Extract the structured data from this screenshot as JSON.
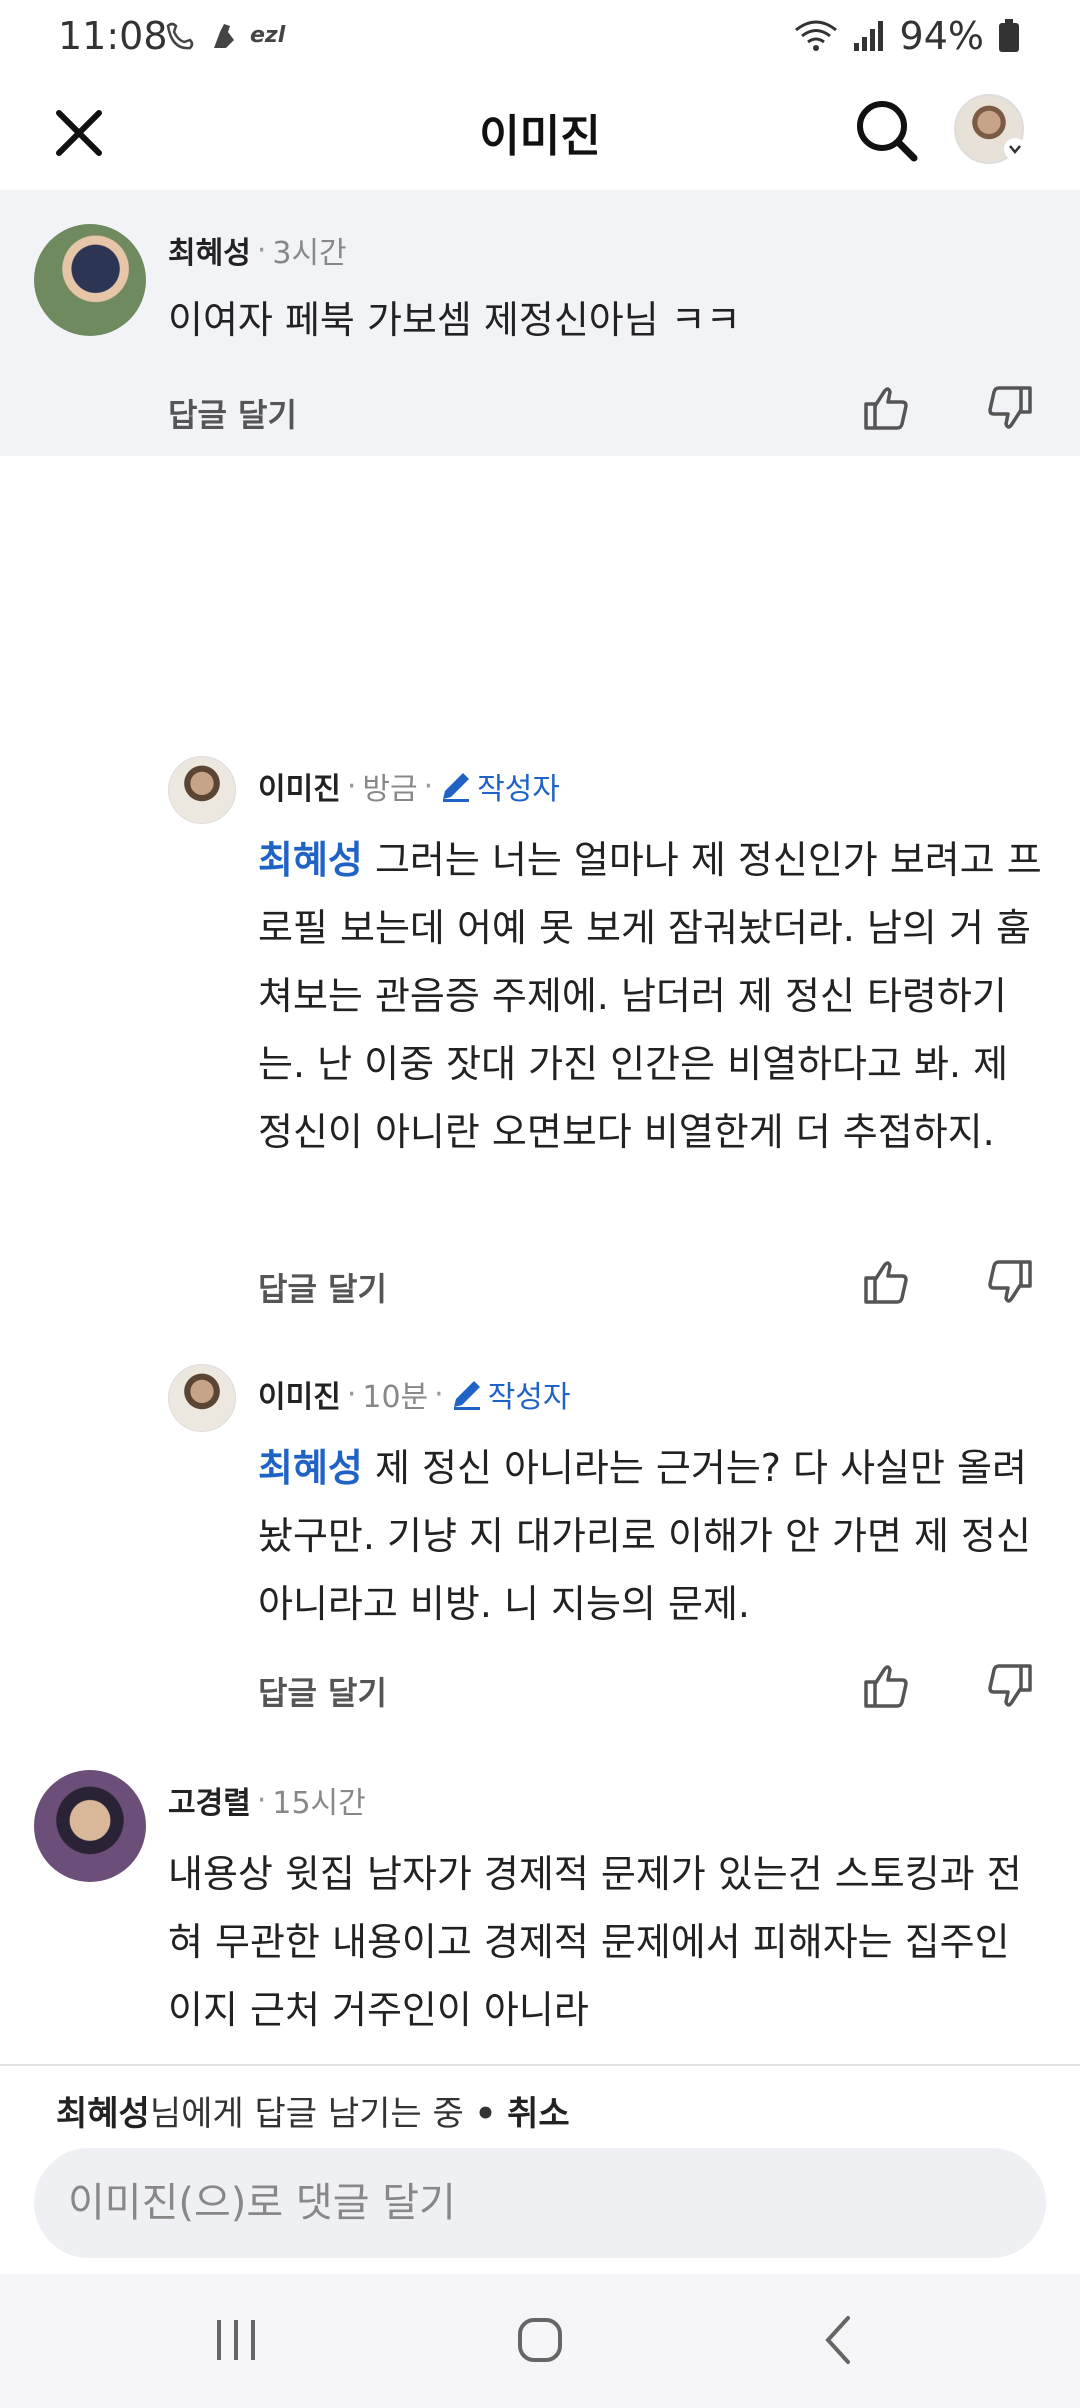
{
  "status_bar": {
    "time": "11:08",
    "app_icons": [
      "who-icon",
      "dog-icon",
      "ezl-icon"
    ],
    "ezl_label": "ezl",
    "battery": "94%"
  },
  "header": {
    "title": "이미진",
    "close_icon": "close-icon",
    "search_icon": "search-icon"
  },
  "comments": [
    {
      "author": "최혜성",
      "time": "3시간",
      "text": "이여자 페북 가보셈 제정신아님 ㅋㅋ",
      "reply_label": "답글 달기"
    },
    {
      "author": "이미진",
      "time": "방금",
      "author_tag": "작성자",
      "mention": "최혜성",
      "text": " 그러는 너는 얼마나 제 정신인가 보려고 프로필 보는데 어예 못 보게 잠궈놨더라. 남의 거 훔쳐보는 관음증 주제에. 남더러 제 정신 타령하기는. 난 이중 잣대 가진 인간은 비열하다고 봐. 제 정신이 아니란 오면보다 비열한게 더 추접하지.",
      "reply_label": "답글 달기"
    },
    {
      "author": "이미진",
      "time": "10분",
      "author_tag": "작성자",
      "mention": "최혜성",
      "text": " 제 정신 아니라는 근거는? 다 사실만 올려놨구만. 기냥 지 대가리로 이해가 안 가면 제 정신 아니라고 비방. 니 지능의 문제.",
      "reply_label": "답글 달기"
    },
    {
      "author": "고경렬",
      "time": "15시간",
      "text": "내용상 윗집 남자가 경제적 문제가 있는건 스토킹과 전혀 무관한 내용이고 경제적 문제에서 피해자는 집주인이지 근처 거주인이 아니라"
    }
  ],
  "composer": {
    "reply_target": "최혜성",
    "reply_suffix": "님에게 답글 남기는 중",
    "dot": "•",
    "cancel": "취소",
    "placeholder": "이미진(으)로 댓글 달기"
  },
  "colors": {
    "accent": "#1f63c6",
    "highlight_bg": "#f2f3f7",
    "input_bg": "#eff0f3"
  }
}
